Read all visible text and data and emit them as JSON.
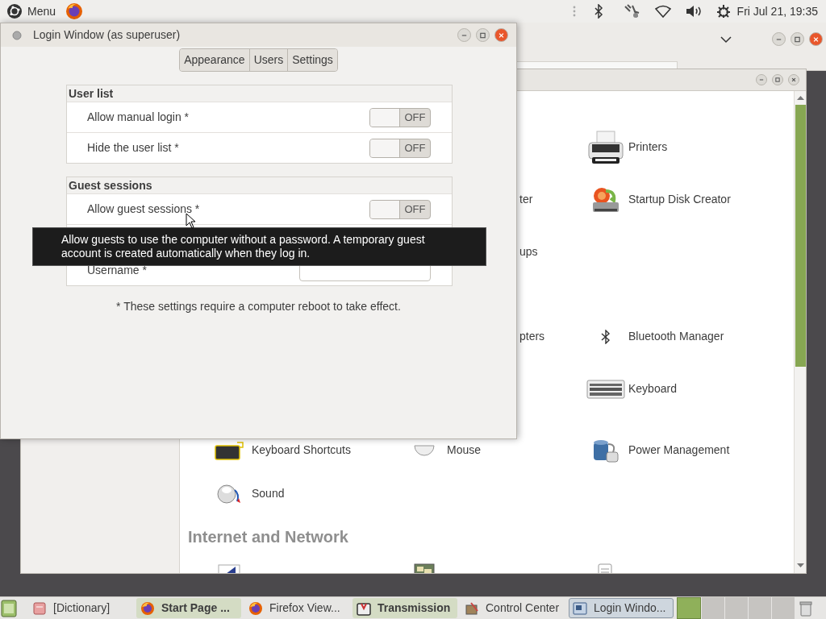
{
  "top_panel": {
    "menu_label": "Menu",
    "clock": "Fri Jul 21, 19:35"
  },
  "control_center": {
    "rows": [
      {
        "column_3": {
          "label": "Printers"
        }
      },
      {
        "column_2": {
          "kind": "partial",
          "label": "ter"
        },
        "column_3": {
          "label": "Startup Disk Creator"
        }
      },
      {
        "column_2": {
          "kind": "partial",
          "label": "ups"
        }
      },
      {
        "kind": "gap"
      },
      {
        "column_2": {
          "kind": "partial",
          "label": "pters"
        },
        "column_3": {
          "label": "Bluetooth Manager"
        }
      },
      {
        "column_3": {
          "label": "Keyboard"
        }
      },
      {
        "column_1": {
          "label": "Keyboard Shortcuts"
        },
        "column_2": {
          "label": "Mouse"
        },
        "column_3": {
          "label": "Power Management"
        }
      },
      {
        "column_1": {
          "label": "Sound"
        }
      },
      {
        "kind": "heading",
        "label": "Internet and Network"
      }
    ]
  },
  "login_window": {
    "title": "Login Window (as superuser)",
    "tabs": [
      {
        "label": "Appearance",
        "selected": false
      },
      {
        "label": "Users",
        "selected": false
      },
      {
        "label": "Settings",
        "selected": false
      }
    ],
    "sections": [
      {
        "title": "User list",
        "rows": [
          {
            "kind": "switch",
            "label": "Allow manual login *",
            "on": false,
            "state_text": "OFF"
          },
          {
            "kind": "switch",
            "label": "Hide the user list *",
            "on": false,
            "state_text": "OFF"
          }
        ]
      },
      {
        "title": "Guest sessions",
        "rows": [
          {
            "kind": "switch",
            "label": "Allow guest sessions *",
            "on": false,
            "state_text": "OFF"
          },
          {
            "kind": "field",
            "label": "Username *"
          }
        ]
      }
    ],
    "note": "* These settings require a computer reboot to take effect.",
    "tooltip": "Allow guests to use the computer without a password. A temporary guest account is created automatically when they log in."
  },
  "taskbar": {
    "items": [
      {
        "label": "[Dictionary]",
        "highlighted": false,
        "selected": false
      },
      {
        "label": "Start Page ...",
        "highlighted": true,
        "selected": false
      },
      {
        "label": "Firefox View...",
        "highlighted": false,
        "selected": false
      },
      {
        "label": "Transmission",
        "highlighted": true,
        "selected": false
      },
      {
        "label": "Control Center",
        "highlighted": false,
        "selected": false
      },
      {
        "label": "Login Windo...",
        "highlighted": false,
        "selected": true
      }
    ]
  }
}
